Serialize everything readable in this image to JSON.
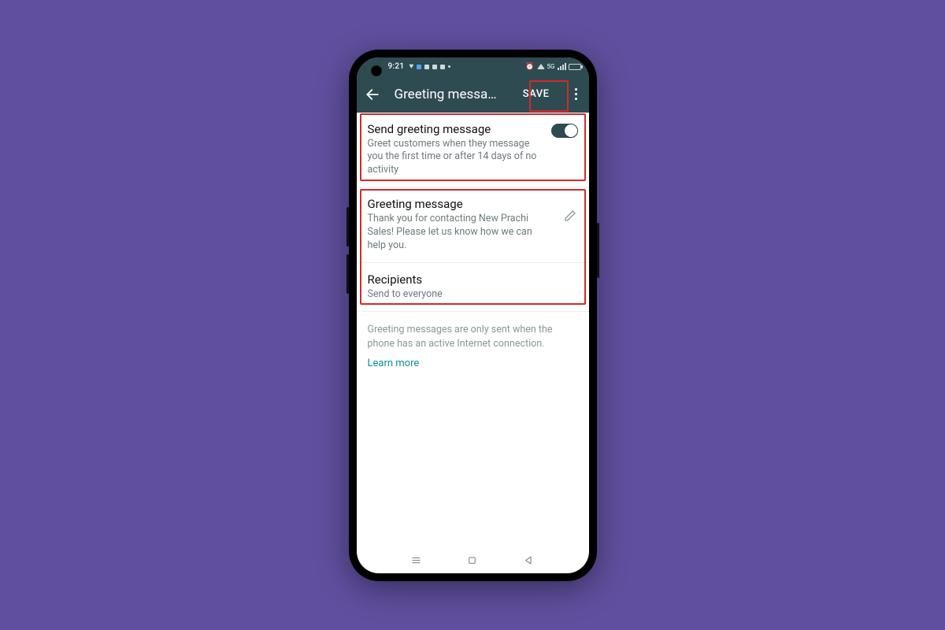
{
  "status": {
    "time": "9:21"
  },
  "appbar": {
    "title": "Greeting messa…",
    "save_label": "SAVE"
  },
  "settings": {
    "send": {
      "title": "Send greeting message",
      "sub": "Greet customers when they message you the first time or after 14 days of no activity",
      "enabled": true
    },
    "message": {
      "title": "Greeting message",
      "sub": "Thank you for contacting New Prachi Sales! Please let us know how we can help you."
    },
    "recipients": {
      "title": "Recipients",
      "sub": "Send to everyone"
    }
  },
  "footer": {
    "note": "Greeting messages are only sent when the phone has an active Internet connection.",
    "learn_more": "Learn more"
  }
}
